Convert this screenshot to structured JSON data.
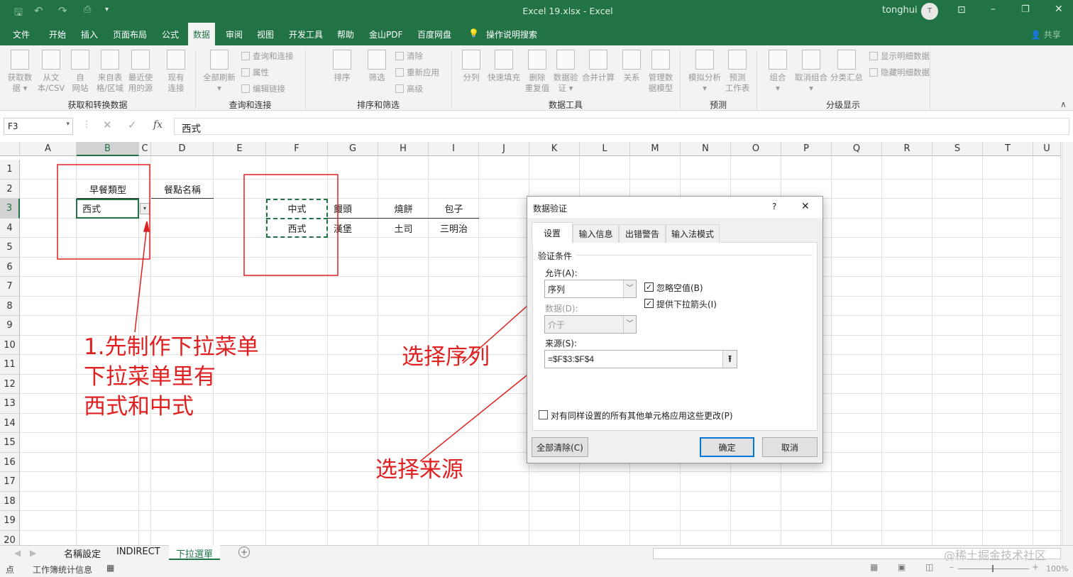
{
  "titlebar": {
    "title": "Excel 19.xlsx  -  Excel",
    "user": "tonghui",
    "avatar": "T",
    "share": "共享"
  },
  "menu": [
    "文件",
    "开始",
    "插入",
    "页面布局",
    "公式",
    "数据",
    "审阅",
    "视图",
    "开发工具",
    "帮助",
    "金山PDF",
    "百度网盘",
    "操作说明搜索"
  ],
  "menu_active": 5,
  "ribbon": {
    "groups": [
      "获取和转换数据",
      "查询和连接",
      "排序和筛选",
      "数据工具",
      "预测",
      "分级显示"
    ],
    "big_buttons": [
      [
        "获取数",
        "据 ▾"
      ],
      [
        "从文",
        "本/CSV"
      ],
      [
        "自",
        "网站"
      ],
      [
        "来自表",
        "格/区域"
      ],
      [
        "最近使",
        "用的源"
      ],
      [
        "现有",
        "连接"
      ],
      [
        "全部刷新",
        "▾"
      ],
      [
        "排序",
        ""
      ],
      [
        "筛选",
        ""
      ],
      [
        "分列",
        ""
      ],
      [
        "快速填充",
        ""
      ],
      [
        "删除",
        "重复值"
      ],
      [
        "数据验",
        "证 ▾"
      ],
      [
        "合并计算",
        ""
      ],
      [
        "关系",
        ""
      ],
      [
        "管理数",
        "据模型"
      ],
      [
        "模拟分析",
        "▾"
      ],
      [
        "预测",
        "工作表"
      ],
      [
        "组合",
        "▾"
      ],
      [
        "取消组合",
        "▾"
      ],
      [
        "分类汇总",
        ""
      ]
    ],
    "small_buttons": [
      "查询和连接",
      "属性",
      "编辑链接",
      "清除",
      "重新应用",
      "高级",
      "显示明细数据",
      "隐藏明细数据"
    ]
  },
  "formula_bar": {
    "name_box": "F3",
    "fx": "fx",
    "value": "西式"
  },
  "columns": [
    "A",
    "B",
    "C",
    "D",
    "E",
    "F",
    "G",
    "H",
    "I",
    "J",
    "K",
    "L",
    "M",
    "N",
    "O",
    "P",
    "Q",
    "R",
    "S",
    "T",
    "U"
  ],
  "rows": [
    "1",
    "2",
    "3",
    "4",
    "5",
    "6",
    "7",
    "8",
    "9",
    "10",
    "11",
    "12",
    "13",
    "14",
    "15",
    "16",
    "17",
    "18",
    "19",
    "20"
  ],
  "cells": [
    {
      "ref": "B2",
      "text": "早餐類型",
      "align": "center"
    },
    {
      "ref": "D2",
      "text": "餐點名稱",
      "align": "center"
    },
    {
      "ref": "B3",
      "text": "西式",
      "align": "left"
    },
    {
      "ref": "F3",
      "text": "中式",
      "align": "center"
    },
    {
      "ref": "F4",
      "text": "西式",
      "align": "center"
    },
    {
      "ref": "G3",
      "text": "饅頭",
      "align": "left"
    },
    {
      "ref": "H3",
      "text": "燒餅",
      "align": "center"
    },
    {
      "ref": "I3",
      "text": "包子",
      "align": "center"
    },
    {
      "ref": "G4",
      "text": "漢堡",
      "align": "left"
    },
    {
      "ref": "H4",
      "text": "土司",
      "align": "center"
    },
    {
      "ref": "I4",
      "text": "三明治",
      "align": "center"
    }
  ],
  "annotations": {
    "step1": [
      "1.先制作下拉菜单",
      "下拉菜单里有",
      "西式和中式"
    ],
    "choose_list": "选择序列",
    "choose_source": "选择来源",
    "color": "#e02020"
  },
  "dialog": {
    "title": "数据验证",
    "help": "?",
    "close": "✕",
    "tabs": [
      "设置",
      "输入信息",
      "出错警告",
      "输入法模式"
    ],
    "section": "验证条件",
    "allow_label": "允许(A):",
    "allow_value": "序列",
    "data_label": "数据(D):",
    "data_value": "介于",
    "ignore_blank": "忽略空值(B)",
    "ignore_blank_checked": true,
    "dropdown": "提供下拉箭头(I)",
    "dropdown_checked": true,
    "source_label": "来源(S):",
    "source_value": "=$F$3:$F$4",
    "apply_all": "对有同样设置的所有其他单元格应用这些更改(P)",
    "apply_all_checked": false,
    "clear_all": "全部清除(C)",
    "ok": "确定",
    "cancel": "取消"
  },
  "sheets": {
    "tabs": [
      "名稱設定",
      "INDIRECT",
      "下拉選單"
    ],
    "active": 2
  },
  "status": {
    "mode": "点",
    "stats": "工作簿统计信息",
    "zoom": "100%"
  },
  "watermark": "@稀土掘金技术社区"
}
